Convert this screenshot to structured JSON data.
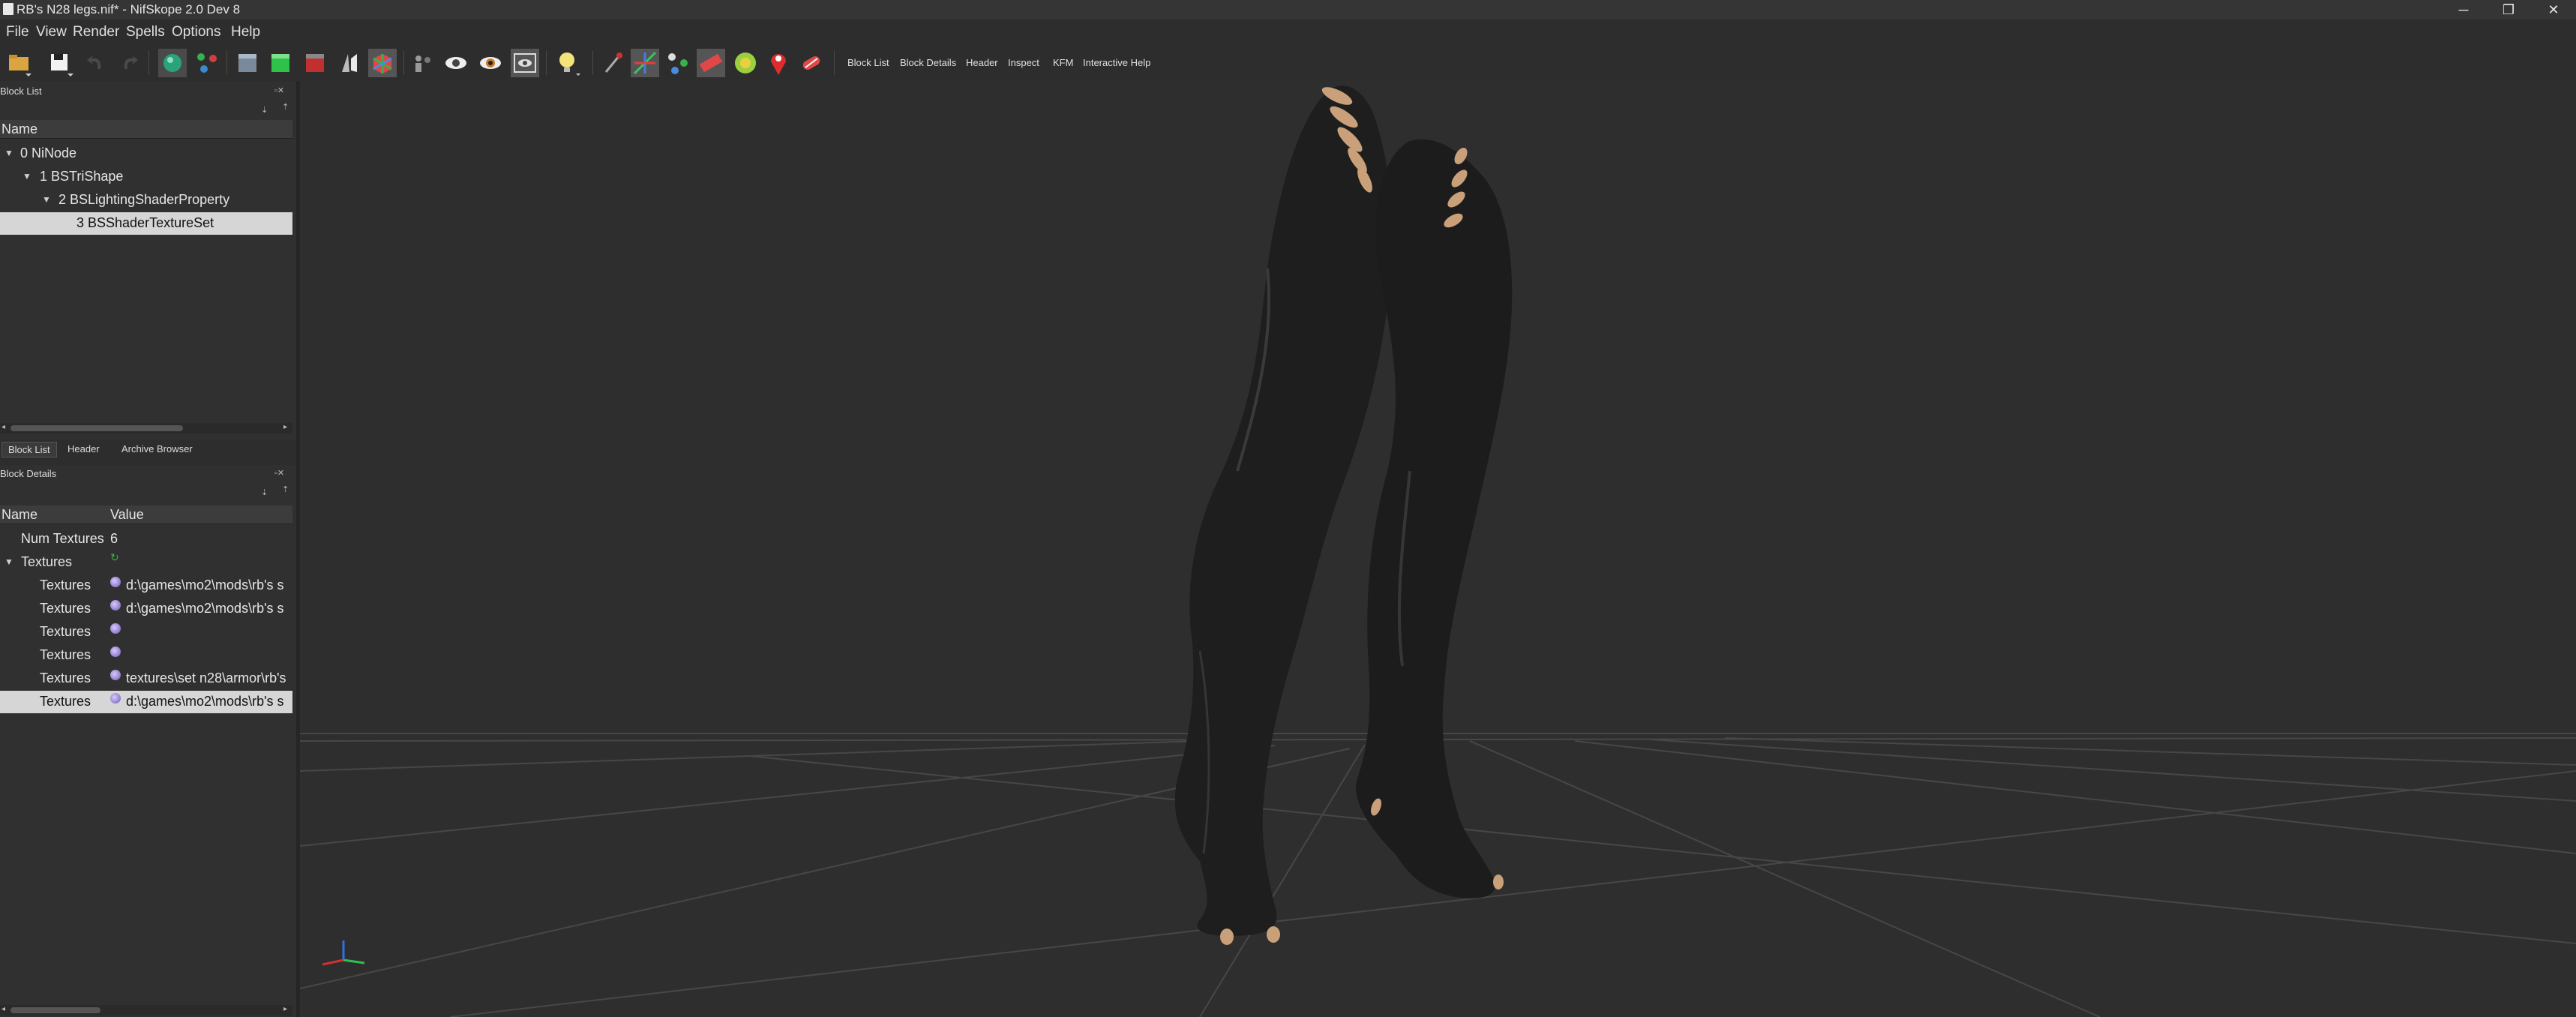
{
  "window": {
    "title": "RB's N28 legs.nif* - NifSkope 2.0 Dev 8",
    "minimize": "─",
    "maximize": "❐",
    "close": "✕"
  },
  "menu": [
    "File",
    "View",
    "Render",
    "Spells",
    "Options",
    "Help"
  ],
  "toolbar": {
    "icons": [
      "open-icon",
      "save-icon",
      "undo-icon",
      "redo-icon",
      "select-object-icon",
      "select-vertex-icon",
      "shaded-view-icon",
      "textures-icon",
      "vertex-colors-icon",
      "normals-icon",
      "wireframe-icon",
      "cube-icon",
      "skeleton-icon",
      "visibility-icon",
      "eye-icon",
      "hidden-icon",
      "light-icon",
      "brush-icon",
      "move-icon",
      "nodes-icon",
      "ruler-icon",
      "green-orb-icon",
      "pin-icon",
      "collision-icon"
    ],
    "text_buttons": [
      "Block List",
      "Block Details",
      "Header",
      "Inspect",
      "KFM",
      "Interactive Help"
    ]
  },
  "block_list": {
    "title": "Block List",
    "column": "Name",
    "rows": [
      {
        "label": "0 NiNode",
        "expanded": true
      },
      {
        "label": "1 BSTriShape",
        "expanded": true
      },
      {
        "label": "2 BSLightingShaderProperty",
        "expanded": true
      },
      {
        "label": "3 BSShaderTextureSet",
        "selected": true
      }
    ]
  },
  "tabs": [
    "Block List",
    "Header",
    "Archive Browser"
  ],
  "block_details": {
    "title": "Block Details",
    "columns": [
      "Name",
      "Value"
    ],
    "num_textures_label": "Num Textures",
    "num_textures_value": "6",
    "textures_label": "Textures",
    "texture_rows": [
      {
        "name": "Textures",
        "value": "d:\\games\\mo2\\mods\\rb's s"
      },
      {
        "name": "Textures",
        "value": "d:\\games\\mo2\\mods\\rb's s"
      },
      {
        "name": "Textures",
        "value": ""
      },
      {
        "name": "Textures",
        "value": ""
      },
      {
        "name": "Textures",
        "value": "textures\\set n28\\armor\\rb's"
      },
      {
        "name": "Textures",
        "value": "d:\\games\\mo2\\mods\\rb's s",
        "selected": true
      }
    ]
  },
  "colors": {
    "background": "#2d2d2d",
    "selection": "#d6d6d6",
    "model": "#1f1f1f",
    "claws": "#c9a07a"
  }
}
